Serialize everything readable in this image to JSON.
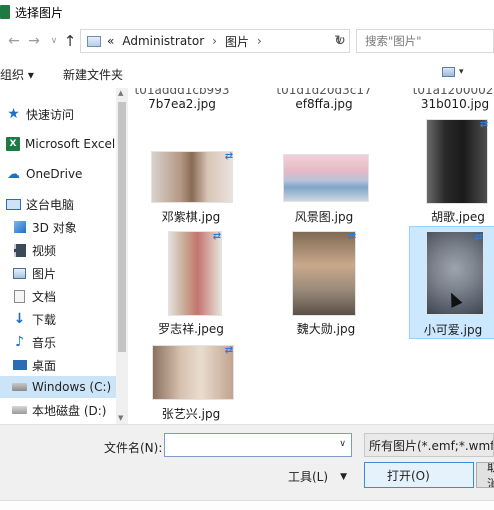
{
  "window": {
    "title": "选择图片"
  },
  "nav": {
    "back": "←",
    "forward": "→",
    "up": "↑",
    "path_prefix": "«",
    "breadcrumbs": [
      "Administrator",
      "图片"
    ],
    "separator": "›",
    "dropdown": "∨",
    "refresh": "↻",
    "search_placeholder": "搜索\"图片\""
  },
  "toolbar": {
    "organize": "组织 ▾",
    "new_folder": "新建文件夹",
    "view_dd": "▾"
  },
  "sidebar": {
    "items": [
      {
        "label": "快速访问",
        "icon": "star-icon"
      },
      {
        "label": "Microsoft Excel",
        "icon": "excel-icon"
      },
      {
        "label": "OneDrive",
        "icon": "cloud-icon"
      },
      {
        "label": "这台电脑",
        "icon": "computer-icon"
      },
      {
        "label": "3D 对象",
        "icon": "cube-icon"
      },
      {
        "label": "视频",
        "icon": "video-icon"
      },
      {
        "label": "图片",
        "icon": "pictures-icon"
      },
      {
        "label": "文档",
        "icon": "documents-icon"
      },
      {
        "label": "下载",
        "icon": "download-icon"
      },
      {
        "label": "音乐",
        "icon": "music-icon"
      },
      {
        "label": "桌面",
        "icon": "desktop-icon"
      },
      {
        "label": "Windows (C:)",
        "icon": "drive-icon"
      },
      {
        "label": "本地磁盘 (D:)",
        "icon": "drive-icon"
      }
    ],
    "excel_badge": "X",
    "scroll_up": "▲",
    "scroll_down": "▼"
  },
  "files": {
    "partial_top": [
      "7b7ea2.jpg",
      "ef8ffa.jpg",
      "31b010.jpg"
    ],
    "partial_top_clipped": [
      "t01addd1cb993",
      "t01d1d20d3c17",
      "t01a1200002"
    ],
    "items": [
      {
        "name": "邓紫棋.jpg",
        "icon": "image-thumbnail"
      },
      {
        "name": "风景图.jpg",
        "icon": "image-thumbnail"
      },
      {
        "name": "胡歌.jpeg",
        "icon": "image-thumbnail"
      },
      {
        "name": "罗志祥.jpeg",
        "icon": "image-thumbnail"
      },
      {
        "name": "魏大勋.jpg",
        "icon": "image-thumbnail"
      },
      {
        "name": "小可爱.jpg",
        "icon": "image-thumbnail"
      },
      {
        "name": "张艺兴.jpg",
        "icon": "image-thumbnail"
      }
    ],
    "share_glyph": "⇄"
  },
  "bottom": {
    "filename_label": "文件名(N):",
    "filename_value": "",
    "filename_dd": "∨",
    "filter": "所有图片(*.emf;*.wmf;*.jpg",
    "tools": "工具(L)",
    "tools_dd": "▼",
    "open": "打开(O)",
    "cancel": "取消"
  }
}
